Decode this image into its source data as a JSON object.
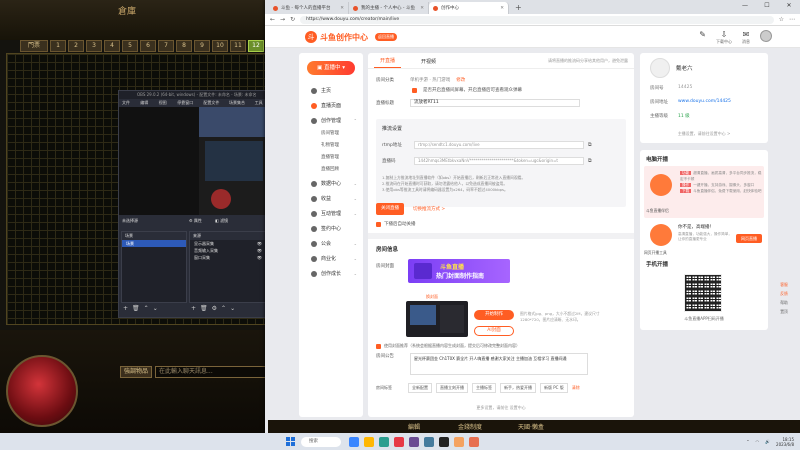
{
  "game": {
    "title": "倉庫",
    "tabs": [
      "門票",
      "1",
      "2",
      "3",
      "4",
      "5",
      "6",
      "7",
      "8",
      "9",
      "10",
      "11",
      "12",
      "13"
    ],
    "active_tab": "12",
    "chat_buttons": [
      "強調物品"
    ],
    "chat_placeholder": "在此輸入聊天訊息...",
    "bottom_labels": [
      "編輯",
      "金錢制度",
      "天國·懶盒"
    ]
  },
  "obs": {
    "title": "OBS 29.0.2 (64-bit, windows) - 配置文件: 未命名 - 场景: 未命名",
    "menu": [
      "文件(F)",
      "编辑(E)",
      "视图(V)",
      "停靠窗口(D)",
      "配置文件(P)",
      "场景集合(S)",
      "工具(T)"
    ],
    "no_source": "未选择源",
    "props_label": "属性",
    "filter_label": "滤镜",
    "scenes_header": "场景",
    "sources_header": "来源",
    "scenes": [
      "场景"
    ],
    "sources": [
      "显示器采集",
      "音频输入采集",
      "窗口采集"
    ]
  },
  "browser": {
    "tabs": [
      {
        "title": "斗鱼 - 每个人的直播平台",
        "active": false
      },
      {
        "title": "我的主播 - 个人中心 - 斗鱼",
        "active": false
      },
      {
        "title": "创作中心",
        "active": true
      }
    ],
    "new_tab": "+",
    "url": "https://www.douyu.com/creator/main/live",
    "window_controls": [
      "—",
      "☐",
      "✕"
    ]
  },
  "header": {
    "logo_text": "斗鱼创作中心",
    "logo_badge": "返回直播",
    "icons": [
      {
        "icon": "tools-icon",
        "label": ""
      },
      {
        "icon": "download-icon",
        "label": "下载中心"
      },
      {
        "icon": "message-icon",
        "label": "消息"
      }
    ],
    "message_count": "20"
  },
  "sidebar": {
    "live_button": "直播中",
    "items": [
      {
        "label": "主页",
        "icon": "home-icon",
        "expandable": false,
        "accent": false
      },
      {
        "label": "直播页面",
        "icon": "live-icon",
        "expandable": false,
        "accent": true
      },
      {
        "label": "创作管理",
        "icon": "create-icon",
        "expandable": true,
        "accent": false
      }
    ],
    "sub_items": [
      "房间管理",
      "礼物管理",
      "直播管理",
      "直播回顾"
    ],
    "items2": [
      {
        "label": "数据中心",
        "icon": "chart-icon"
      },
      {
        "label": "收益",
        "icon": "money-icon"
      },
      {
        "label": "互动管理",
        "icon": "chat-icon"
      },
      {
        "label": "签约中心",
        "icon": "sign-icon"
      },
      {
        "label": "公会",
        "icon": "guild-icon"
      },
      {
        "label": "商业化",
        "icon": "shop-icon"
      },
      {
        "label": "创作成长",
        "icon": "growth-icon"
      }
    ]
  },
  "main": {
    "tabs": [
      "开直播",
      "开视频"
    ],
    "active_tab": "开直播",
    "tip_text": "请将直播的推流码分享给其他用户，避免泄露",
    "tip_link": "",
    "category_label": "房间分类",
    "category_value": "单机手游 · 热门游戏",
    "category_link": "修改",
    "show_chk_label": "是否开启直播间屏幕，开启直播后可查看观众弹幕",
    "title_label": "直播标题",
    "title_value": "流放者RT11",
    "push_title": "推流设置",
    "rtmp_label": "rtmp地址",
    "rtmp_value": "rtmp://sendtc1.douyu.com/live",
    "key_label": "直播码",
    "key_value": "1442hmqs3MEtbkvxaNnV**********************&token=ugc&origin=t",
    "notes": [
      "1.复制上方推流地址到直播软件（如obs）开始直播后，刷新后正常进入直播间观看。",
      "2.推流码在开始直播时可获取，请勿泄露给他人，以免造成直播间被盗用。",
      "3.使用obs等推流工具时请将编码器设置为x264，码率不超过4000kbps。"
    ],
    "start_btn": "关闭直播",
    "start_link": "切换推流方式 >",
    "auto_chk_label": "下播后自动关播",
    "room_section": "房间信息",
    "cover_label": "房间封面",
    "banner_line1": "斗鱼直播",
    "banner_line2": "热门封面制作指南",
    "upload_link": "换封面",
    "btn_primary": "开始制作",
    "btn_secondary": "AI封面",
    "cover_note": "图片格式jpg、png，大小不超过2M，建议尺寸1280*720，图片应清晰、无水印。",
    "smart_chk": "使用封面推荐（系统会根据直播内容生成封面，提交后可修改完整封面内容）",
    "notice_label": "房间公告",
    "notice_text": "星光杯赛团金 Ch1T0X 赛全片 开人嗨直播 感谢大家关注 主播加油 互相学习 直播间通",
    "tags_label": "房间标签",
    "tags": [
      "全新配置",
      "直播立刻开播",
      "主播标签",
      "新手，热爱开播",
      "新版 PC 版"
    ],
    "tags_x": "清除",
    "footer": "更多设置，请前往 设置中心"
  },
  "profile": {
    "name": "戴老六",
    "rows": [
      {
        "k": "房间号",
        "v": "14425",
        "c": ""
      },
      {
        "k": "房间地址",
        "v": "www.douyu.com/14425",
        "c": "b"
      },
      {
        "k": "主播等级",
        "v": "11 级",
        "c": "g"
      }
    ],
    "footer": "主播设置，请前往设置中心 >"
  },
  "promo": {
    "title": "电脑开播",
    "lines": [
      {
        "tag": "功能",
        "text": "超清直播，画质高清，多平台同步推流，稳定不卡顿"
      },
      {
        "tag": "操作",
        "text": "一键开播，支持游戏、摄像头、多窗口"
      },
      {
        "tag": "下载",
        "text": "斗鱼直播伴侣，免费下载使用，赶快体验吧"
      }
    ],
    "cap1": "斗鱼直播伴侣",
    "promo2_title": "你不是，高端播！",
    "promo2_desc": "高清直播，功能强大，操作简单，让你的直播更专业",
    "promo2_btn": "网页直播",
    "cap2": "网页开播工具",
    "mobile_title": "手机开播",
    "qr_caption": "斗鱼直播APP扫码开播"
  },
  "rstrip": [
    "客服",
    "反馈",
    "帮助",
    "置顶"
  ],
  "taskbar": {
    "search": "搜索",
    "time": "18:15",
    "date": "2023/6/8",
    "icons": [
      "#3a86ff",
      "#ffb703",
      "#2a9d8f",
      "#e63946",
      "#6a4c93",
      "#457b9d",
      "#222222",
      "#f4a261",
      "#e76f51"
    ]
  }
}
